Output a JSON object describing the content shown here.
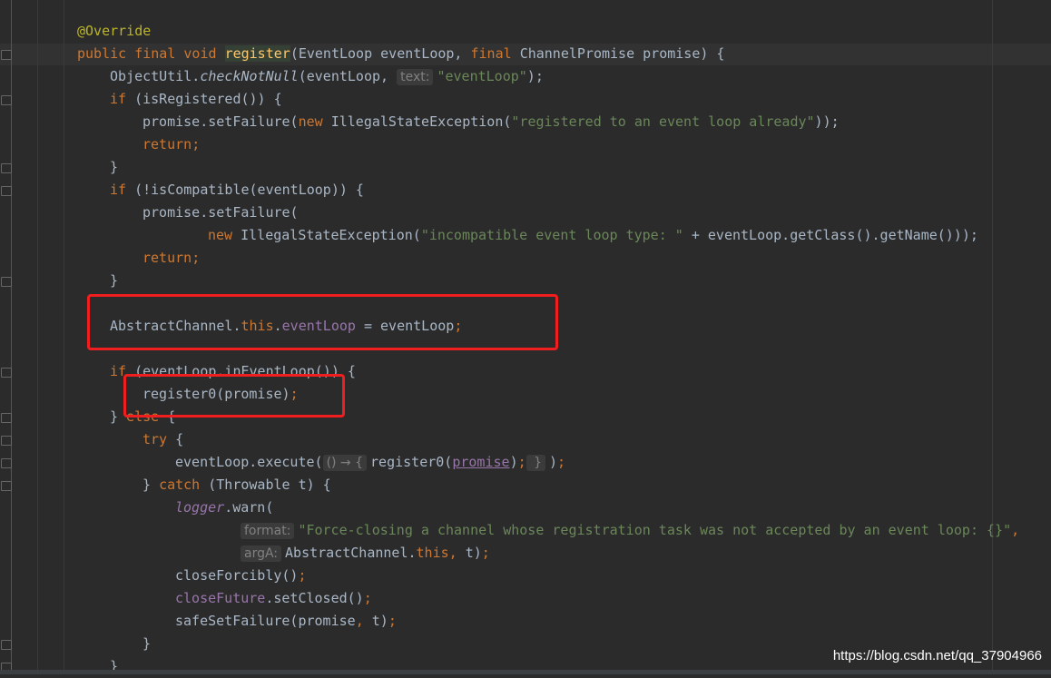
{
  "editor": {
    "colors": {
      "background": "#2b2b2b",
      "keyword": "#cc7832",
      "function": "#ffc66d",
      "string": "#6a8759",
      "field": "#9876aa",
      "text": "#a9b7c6",
      "annotation": "#bbb529",
      "highlight_box": "#f01e1e"
    },
    "lines": [
      {
        "indent": 0,
        "tokens": [
          [
            "@Override",
            "ann"
          ]
        ]
      },
      {
        "indent": 0,
        "tokens": [
          [
            "public final void ",
            "kw"
          ],
          [
            "register",
            "fnhl"
          ],
          [
            "(EventLoop eventLoop, ",
            ""
          ],
          [
            "final ",
            "kw"
          ],
          [
            "ChannelPromise promise) {",
            ""
          ]
        ]
      },
      {
        "indent": 4,
        "tokens": [
          [
            "ObjectUtil.",
            ""
          ],
          [
            "checkNotNull",
            "it"
          ],
          [
            "(eventLoop, ",
            ""
          ],
          [
            "text:",
            "hint"
          ],
          [
            "\"eventLoop\"",
            "str"
          ],
          [
            ");",
            ""
          ]
        ]
      },
      {
        "indent": 4,
        "tokens": [
          [
            "if ",
            "kw"
          ],
          [
            "(isRegistered()) {",
            ""
          ]
        ]
      },
      {
        "indent": 8,
        "tokens": [
          [
            "promise.setFailure(",
            ""
          ],
          [
            "new ",
            "kw"
          ],
          [
            "IllegalStateException(",
            ""
          ],
          [
            "\"registered to an event loop already\"",
            "str"
          ],
          [
            "));",
            ""
          ]
        ]
      },
      {
        "indent": 8,
        "tokens": [
          [
            "return",
            "kw"
          ],
          [
            ";",
            "kw"
          ]
        ]
      },
      {
        "indent": 4,
        "tokens": [
          [
            "}",
            ""
          ]
        ]
      },
      {
        "indent": 4,
        "tokens": [
          [
            "if ",
            "kw"
          ],
          [
            "(!isCompatible(eventLoop)) {",
            ""
          ]
        ]
      },
      {
        "indent": 8,
        "tokens": [
          [
            "promise.setFailure(",
            ""
          ]
        ]
      },
      {
        "indent": 16,
        "tokens": [
          [
            "new ",
            "kw"
          ],
          [
            "IllegalStateException(",
            ""
          ],
          [
            "\"incompatible event loop type: \"",
            "str"
          ],
          [
            " + eventLoop.getClass().getName()));",
            ""
          ]
        ]
      },
      {
        "indent": 8,
        "tokens": [
          [
            "return",
            "kw"
          ],
          [
            ";",
            "kw"
          ]
        ]
      },
      {
        "indent": 4,
        "tokens": [
          [
            "}",
            ""
          ]
        ]
      },
      {
        "indent": 0,
        "tokens": []
      },
      {
        "indent": 4,
        "tokens": [
          [
            "AbstractChannel.",
            ""
          ],
          [
            "this",
            "kw"
          ],
          [
            ".",
            ""
          ],
          [
            "eventLoop",
            "field"
          ],
          [
            " = eventLoop",
            ""
          ],
          [
            ";",
            "kw"
          ]
        ]
      },
      {
        "indent": 0,
        "tokens": []
      },
      {
        "indent": 4,
        "tokens": [
          [
            "if ",
            "kw"
          ],
          [
            "(eventLoop.inEventLoop()) {",
            ""
          ]
        ]
      },
      {
        "indent": 8,
        "tokens": [
          [
            "register0(promise)",
            ""
          ],
          [
            ";",
            "kw"
          ]
        ]
      },
      {
        "indent": 4,
        "tokens": [
          [
            "} ",
            ""
          ],
          [
            "else ",
            "kw"
          ],
          [
            "{",
            ""
          ]
        ]
      },
      {
        "indent": 8,
        "tokens": [
          [
            "try ",
            "kw"
          ],
          [
            "{",
            ""
          ]
        ]
      },
      {
        "indent": 12,
        "tokens": [
          [
            "eventLoop.execute(",
            ""
          ],
          [
            "() → {",
            "hint"
          ],
          [
            "register0(",
            ""
          ],
          [
            "promise",
            "ul"
          ],
          [
            ")",
            ""
          ],
          [
            ";",
            "kw"
          ],
          [
            " }",
            "hint"
          ],
          [
            ")",
            ""
          ],
          [
            ";",
            "kw"
          ]
        ]
      },
      {
        "indent": 8,
        "tokens": [
          [
            "} ",
            ""
          ],
          [
            "catch ",
            "kw"
          ],
          [
            "(Throwable t) {",
            ""
          ]
        ]
      },
      {
        "indent": 12,
        "tokens": [
          [
            "logger",
            "itf"
          ],
          [
            ".warn(",
            ""
          ]
        ]
      },
      {
        "indent": 20,
        "tokens": [
          [
            "format:",
            "hint"
          ],
          [
            "\"Force-closing a channel whose registration task was not accepted by an event loop: {}\"",
            "str"
          ],
          [
            ",",
            "kw"
          ]
        ]
      },
      {
        "indent": 20,
        "tokens": [
          [
            "argA:",
            "hint"
          ],
          [
            "AbstractChannel.",
            ""
          ],
          [
            "this",
            "kw"
          ],
          [
            ", ",
            "kw"
          ],
          [
            "t)",
            ""
          ],
          [
            ";",
            "kw"
          ]
        ]
      },
      {
        "indent": 12,
        "tokens": [
          [
            "closeForcibly()",
            ""
          ],
          [
            ";",
            "kw"
          ]
        ]
      },
      {
        "indent": 12,
        "tokens": [
          [
            "closeFuture",
            "field"
          ],
          [
            ".setClosed()",
            ""
          ],
          [
            ";",
            "kw"
          ]
        ]
      },
      {
        "indent": 12,
        "tokens": [
          [
            "safeSetFailure(promise",
            ""
          ],
          [
            ", ",
            "kw"
          ],
          [
            "t)",
            ""
          ],
          [
            ";",
            "kw"
          ]
        ]
      },
      {
        "indent": 8,
        "tokens": [
          [
            "}",
            ""
          ]
        ]
      },
      {
        "indent": 4,
        "tokens": [
          [
            "}",
            ""
          ]
        ]
      }
    ]
  },
  "watermark": "https://blog.csdn.net/qq_37904966"
}
